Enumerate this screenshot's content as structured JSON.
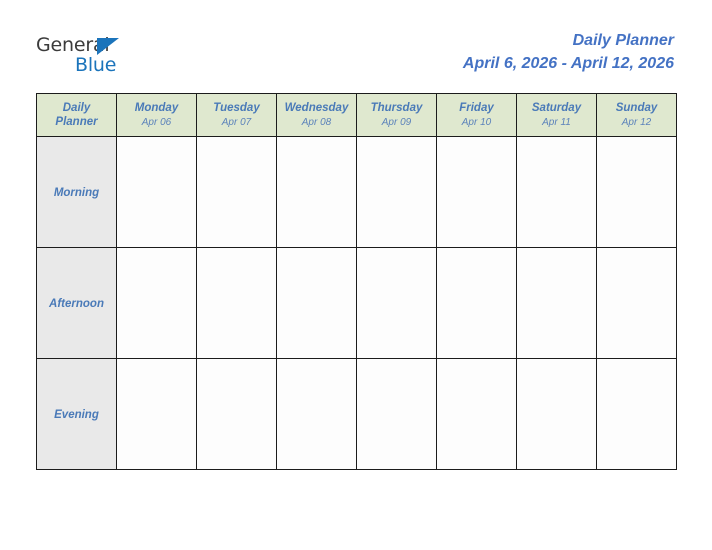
{
  "brand": {
    "name_part1": "General",
    "name_part2": "Blue",
    "triangle_icon": "triangle-logo-icon",
    "accent_blue": "#1b74bb"
  },
  "header": {
    "title": "Daily Planner",
    "date_range": "April 6, 2026 - April 12, 2026"
  },
  "colors": {
    "header_green": "#dfe8cf",
    "row_label_gray": "#e9e9e9",
    "text_blue": "#4a7ab8",
    "title_blue": "#4472c4",
    "border": "#1c1c1c"
  },
  "table": {
    "corner": {
      "line1": "Daily",
      "line2": "Planner"
    },
    "columns": [
      {
        "day": "Monday",
        "date": "Apr 06"
      },
      {
        "day": "Tuesday",
        "date": "Apr 07"
      },
      {
        "day": "Wednesday",
        "date": "Apr 08"
      },
      {
        "day": "Thursday",
        "date": "Apr 09"
      },
      {
        "day": "Friday",
        "date": "Apr 10"
      },
      {
        "day": "Saturday",
        "date": "Apr 11"
      },
      {
        "day": "Sunday",
        "date": "Apr 12"
      }
    ],
    "rows": [
      {
        "label": "Morning",
        "cells": [
          "",
          "",
          "",
          "",
          "",
          "",
          ""
        ]
      },
      {
        "label": "Afternoon",
        "cells": [
          "",
          "",
          "",
          "",
          "",
          "",
          ""
        ]
      },
      {
        "label": "Evening",
        "cells": [
          "",
          "",
          "",
          "",
          "",
          "",
          ""
        ]
      }
    ]
  }
}
